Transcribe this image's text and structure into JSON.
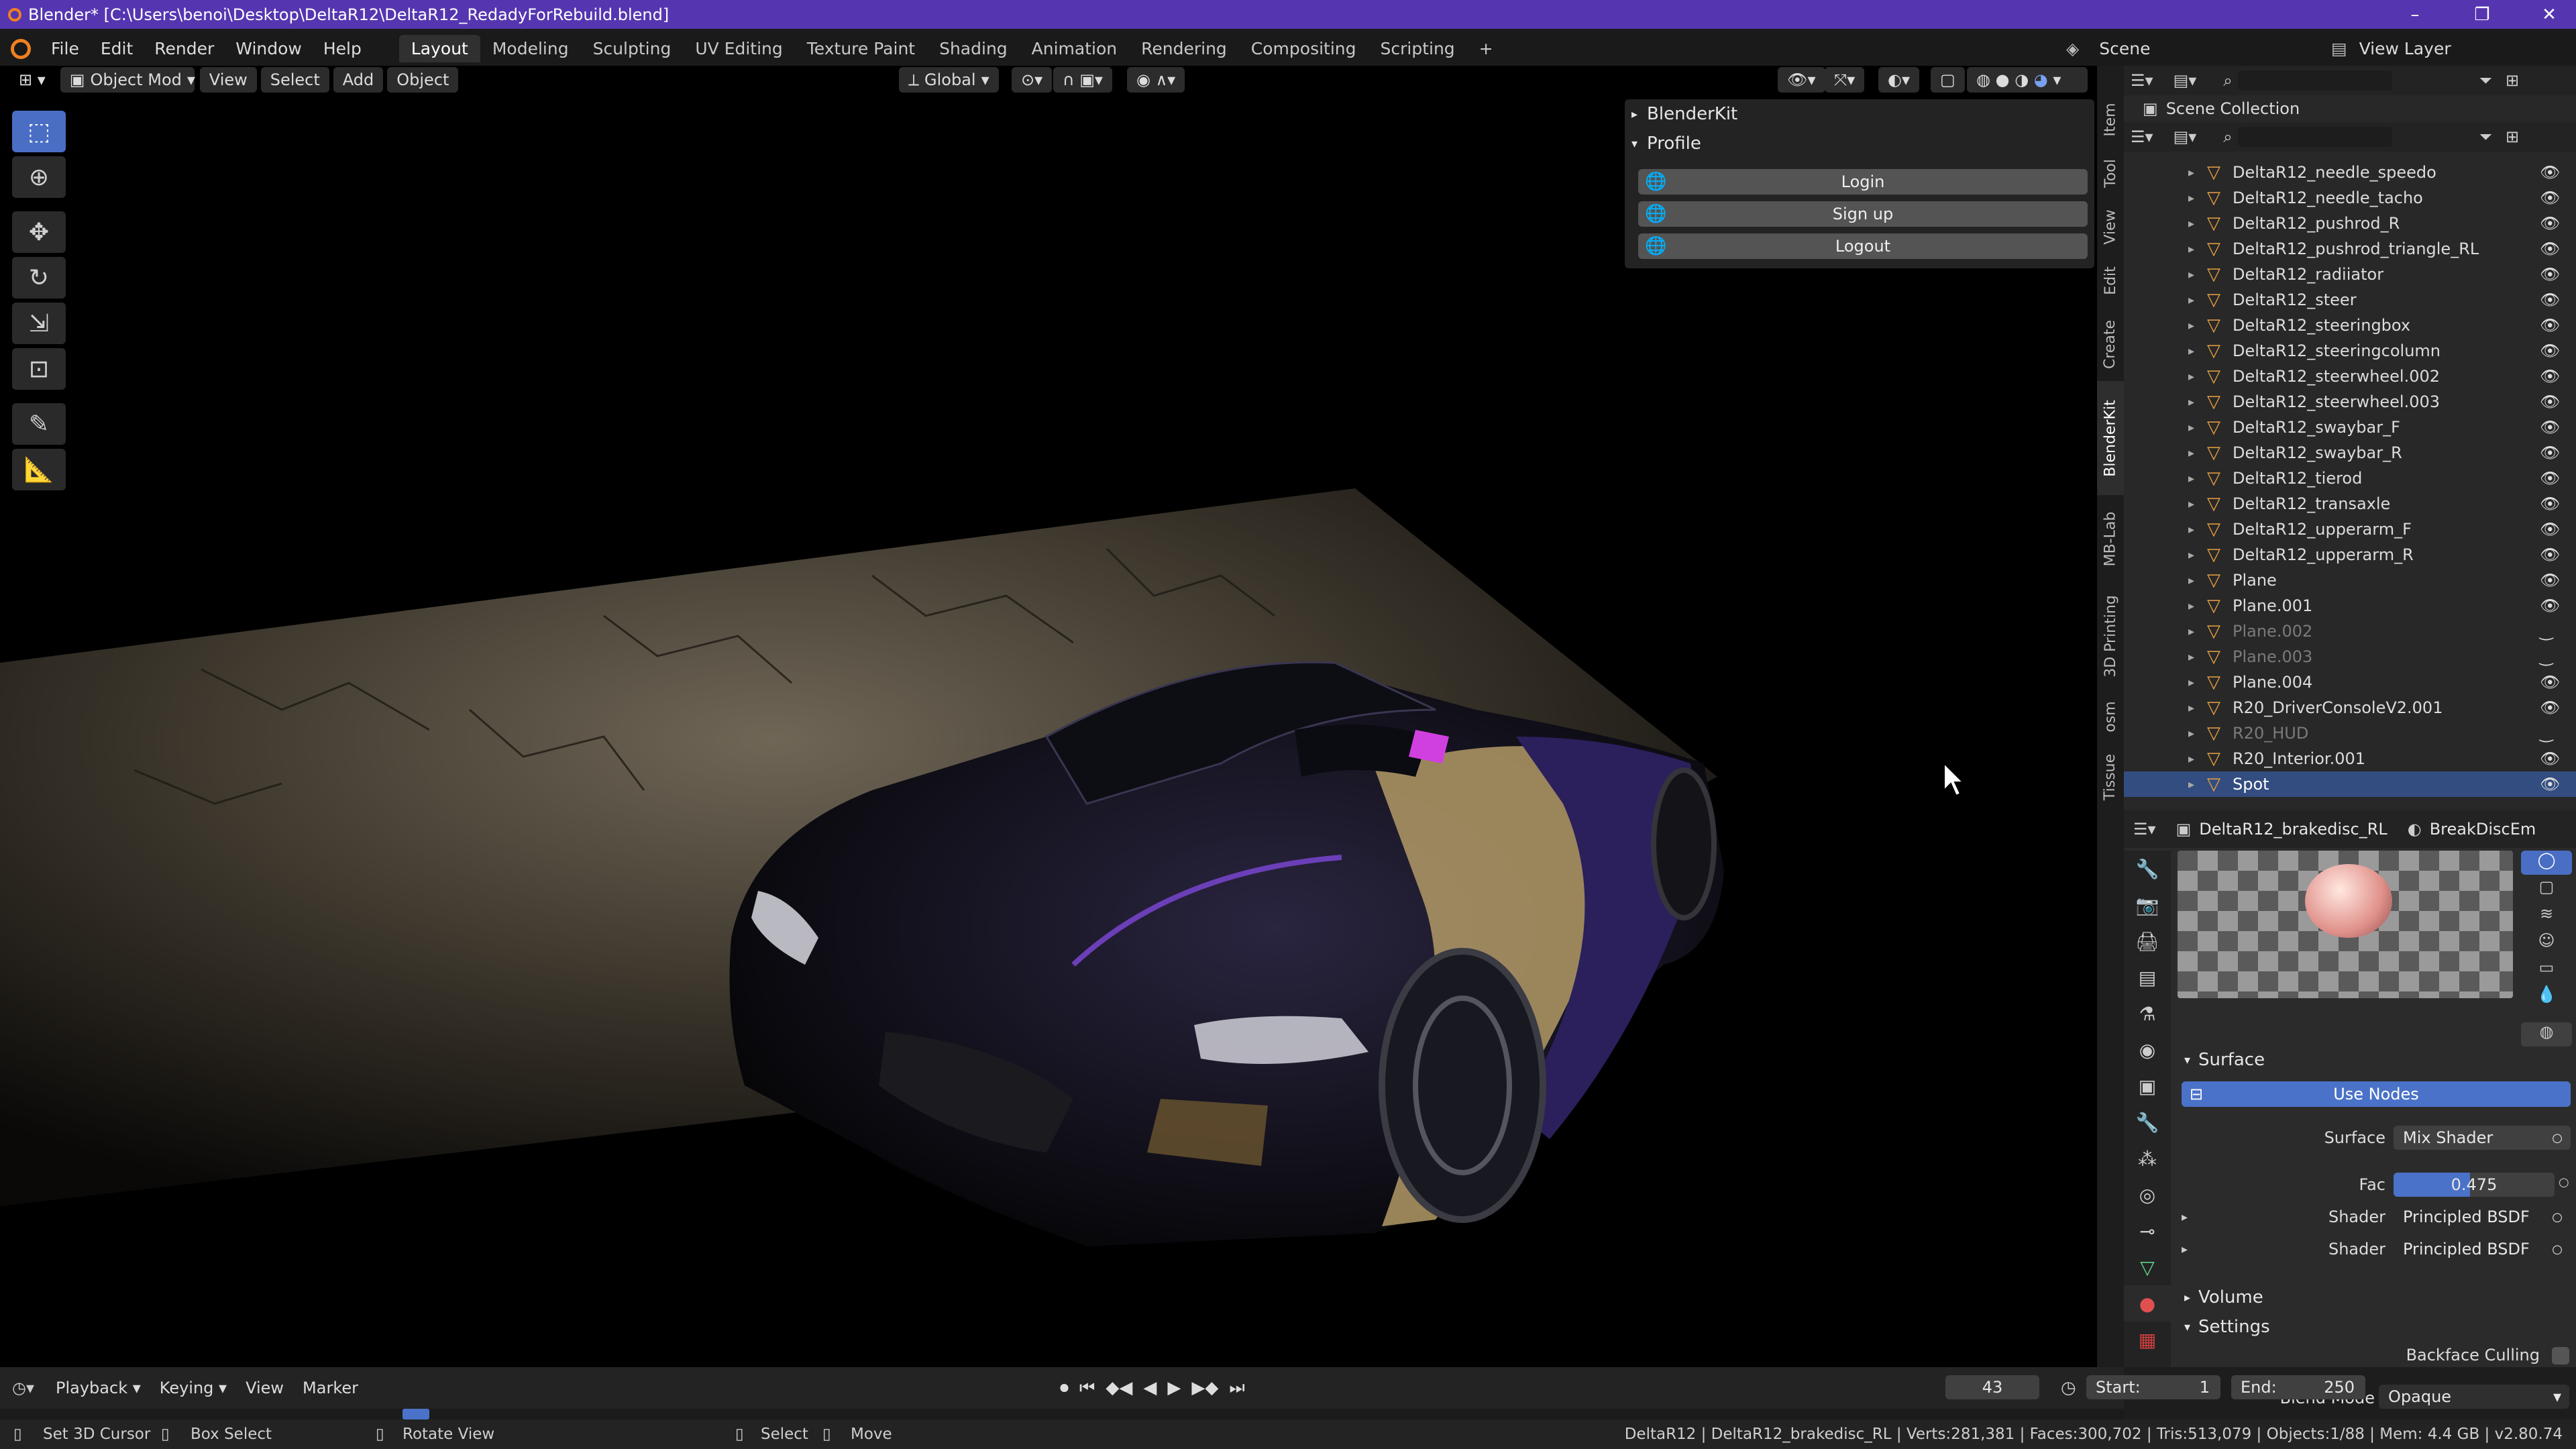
{
  "window": {
    "title": "Blender* [C:\\Users\\benoi\\Desktop\\DeltaR12\\DeltaR12_RedadyForRebuild.blend]",
    "controls": [
      "–",
      "❐",
      "✕"
    ]
  },
  "menu": [
    "File",
    "Edit",
    "Render",
    "Window",
    "Help"
  ],
  "workspaces": [
    "Layout",
    "Modeling",
    "Sculpting",
    "UV Editing",
    "Texture Paint",
    "Shading",
    "Animation",
    "Rendering",
    "Compositing",
    "Scripting"
  ],
  "active_workspace": "Layout",
  "scene": {
    "label": "Scene",
    "view_layer": "View Layer"
  },
  "viewport_header": {
    "mode": "Object Mod",
    "menus": [
      "View",
      "Select",
      "Add",
      "Object"
    ],
    "orientation": "Global"
  },
  "blenderkit": {
    "title": "BlenderKit",
    "profile": "Profile",
    "buttons": [
      "Login",
      "Sign up",
      "Logout"
    ]
  },
  "side_tabs": [
    "Item",
    "Tool",
    "View",
    "Edit",
    "Create",
    "BlenderKit",
    "MB-Lab",
    "3D Printing",
    "osm",
    "Tissue"
  ],
  "outliner": {
    "title": "Scene Collection",
    "items": [
      {
        "name": "DeltaR12_needle_speedo",
        "dim": false
      },
      {
        "name": "DeltaR12_needle_tacho",
        "dim": false
      },
      {
        "name": "DeltaR12_pushrod_R",
        "dim": false
      },
      {
        "name": "DeltaR12_pushrod_triangle_RL",
        "dim": false
      },
      {
        "name": "DeltaR12_radiiator",
        "dim": false
      },
      {
        "name": "DeltaR12_steer",
        "dim": false
      },
      {
        "name": "DeltaR12_steeringbox",
        "dim": false
      },
      {
        "name": "DeltaR12_steeringcolumn",
        "dim": false
      },
      {
        "name": "DeltaR12_steerwheel.002",
        "dim": false
      },
      {
        "name": "DeltaR12_steerwheel.003",
        "dim": false
      },
      {
        "name": "DeltaR12_swaybar_F",
        "dim": false
      },
      {
        "name": "DeltaR12_swaybar_R",
        "dim": false
      },
      {
        "name": "DeltaR12_tierod",
        "dim": false
      },
      {
        "name": "DeltaR12_transaxle",
        "dim": false
      },
      {
        "name": "DeltaR12_upperarm_F",
        "dim": false
      },
      {
        "name": "DeltaR12_upperarm_R",
        "dim": false
      },
      {
        "name": "Plane",
        "dim": false
      },
      {
        "name": "Plane.001",
        "dim": false
      },
      {
        "name": "Plane.002",
        "dim": true
      },
      {
        "name": "Plane.003",
        "dim": true
      },
      {
        "name": "Plane.004",
        "dim": false
      },
      {
        "name": "R20_DriverConsoleV2.001",
        "dim": false
      },
      {
        "name": "R20_HUD",
        "dim": true
      },
      {
        "name": "R20_Interior.001",
        "dim": false
      },
      {
        "name": "Spot",
        "dim": false,
        "selected": true
      }
    ]
  },
  "properties": {
    "object": "DeltaR12_brakedisc_RL",
    "material": "BreakDiscEm",
    "surface_section": "Surface",
    "use_nodes": "Use Nodes",
    "surface_label": "Surface",
    "surface_value": "Mix Shader",
    "fac_label": "Fac",
    "fac_value": "0.475",
    "fac_fraction": 0.475,
    "shader_label": "Shader",
    "shader1": "Principled BSDF",
    "shader2": "Principled BSDF",
    "volume_section": "Volume",
    "settings_section": "Settings",
    "backface_label": "Backface Culling",
    "blend_label": "Blend Mode",
    "blend_value": "Opaque"
  },
  "timeline": {
    "menus": [
      "Playback",
      "Keying",
      "View",
      "Marker"
    ],
    "frame": "43",
    "start_label": "Start:",
    "start": "1",
    "end_label": "End:",
    "end": "250"
  },
  "status": {
    "left1": "Set 3D Cursor",
    "left2": "Box Select",
    "mid1": "Rotate View",
    "mid2": "Select",
    "mid3": "Move",
    "right": "DeltaR12 | DeltaR12_brakedisc_RL | Verts:281,381 | Faces:300,702 | Tris:513,079 | Objects:1/88 | Mem: 4.4 GB | v2.80.74"
  },
  "colors": {
    "accent": "#5536b0",
    "selection": "#334d80",
    "fac_bar": "#4a72c8"
  }
}
